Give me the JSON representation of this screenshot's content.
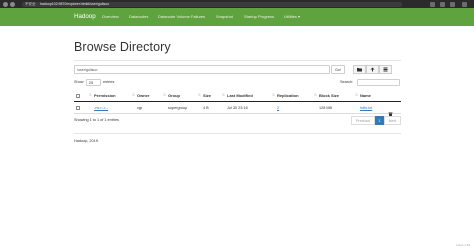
{
  "browser": {
    "security_label": "不安全",
    "url": "hadoop102:9870/explorer.html#/user/gulisuo"
  },
  "navbar": {
    "brand": "Hadoop",
    "items": [
      "Overview",
      "Datanodes",
      "Datanode Volume Failures",
      "Snapshot",
      "Startup Progress",
      "Utilities ▾"
    ]
  },
  "page": {
    "title": "Browse Directory"
  },
  "directory": {
    "path": "/user/gulisuo",
    "go_label": "Go!",
    "icons": [
      "folder-icon",
      "upload-icon",
      "list-icon"
    ]
  },
  "table_controls": {
    "show_label": "Show",
    "show_value": "25",
    "entries_label": "entries",
    "search_label": "Search:",
    "search_value": ""
  },
  "table": {
    "headers": [
      "Permission",
      "Owner",
      "Group",
      "Size",
      "Last Modified",
      "Replication",
      "Block Size",
      "Name"
    ],
    "rows": [
      {
        "permission": "-rw-r--r--",
        "owner": "xgr",
        "group": "supergroup",
        "size": "4 B",
        "last_modified": "Jul 30 23:16",
        "replication": "2",
        "block_size": "128 MB",
        "name": "hdfs.txt"
      }
    ],
    "showing_text": "Showing 1 to 1 of 1 entries",
    "pagination": {
      "previous": "Previous",
      "current": "1",
      "next": "Next"
    }
  },
  "footer": {
    "text": "Hadoop, 2019."
  },
  "taskbar": {
    "text": "Linux x 64"
  },
  "colors": {
    "navbar": "#5fa33e",
    "link": "#337ab7",
    "active_page": "#337ab7"
  }
}
